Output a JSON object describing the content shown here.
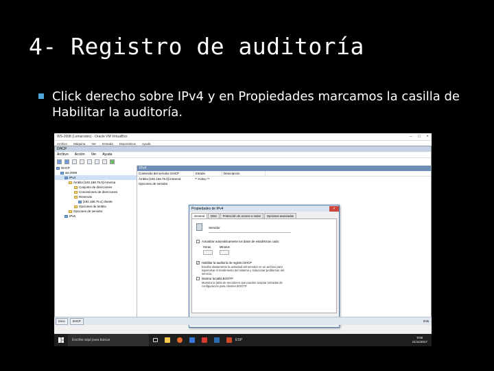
{
  "slide": {
    "title": "4- Registro de auditoría",
    "bullet_text": "Click derecho sobre IPv4 y en Propiedades marcamos la casilla de Habilitar la auditoría."
  },
  "colors": {
    "background": "#000000",
    "bullet": "#4ea3d8",
    "dialog_border": "#4d7bb3"
  },
  "vm_window": {
    "title": "WS-2008 (Lomarodes) - Oracle VM VirtualBox",
    "menu": [
      "Archivo",
      "Máquina",
      "Ver",
      "Entrada",
      "Dispositivos",
      "Ayuda"
    ]
  },
  "dhcp_window": {
    "title": "DHCP",
    "menu": [
      "Archivo",
      "Acción",
      "Ver",
      "Ayuda"
    ],
    "tree": [
      "DHCP",
      "ws-2008",
      "IPv4",
      "Ámbito [192.168.75.0] inmersa",
      "Conjunto de direcciones",
      "Concesiones de direcciones",
      "Reservas",
      "[192.168.75.x] cliente",
      "Opciones de ámbito",
      "Opciones de servidor",
      "IPv6"
    ],
    "pane_header": "IPv4",
    "columns": [
      "Contenido del servidor DHCP",
      "Estado",
      "Descripción"
    ],
    "rows": [
      {
        "name": "Ámbito [192.168.75.0] inmersa",
        "state": "** Activo **",
        "desc": ""
      },
      {
        "name": "Opciones de servidor",
        "state": "",
        "desc": ""
      }
    ]
  },
  "dialog": {
    "title": "Propiedades de IPv4",
    "tabs": [
      "General",
      "DNS",
      "Protección de acceso a redes",
      "Opciones avanzadas"
    ],
    "server_label": "Servidor",
    "auto_update": "Actualizar automáticamente los datos de estadísticas cada:",
    "hours_label": "Horas",
    "minutes_label": "Minutos",
    "audit_label": "Habilitar la auditoría de registro DHCP",
    "audit_desc": "Escribe diariamente la actividad del servidor en un archivo para supervisar el rendimiento del sistema y solucionar problemas del servicio.",
    "bootp_label": "Mostrar la tabla BOOTP",
    "bootp_desc": "Muestra la tabla de servidores que pueden aceptar entradas de configuración para clientes BOOTP.",
    "buttons": [
      "Aceptar",
      "Cancelar",
      "Aplicar"
    ]
  },
  "vm_statusbar": {
    "tasks": [
      "Inicio",
      "DHCP"
    ],
    "clock": "9:55"
  },
  "host_taskbar": {
    "search_placeholder": "Escribe aquí para buscar",
    "time": "9:55",
    "date": "21/11/2017",
    "tray": "ESP"
  }
}
